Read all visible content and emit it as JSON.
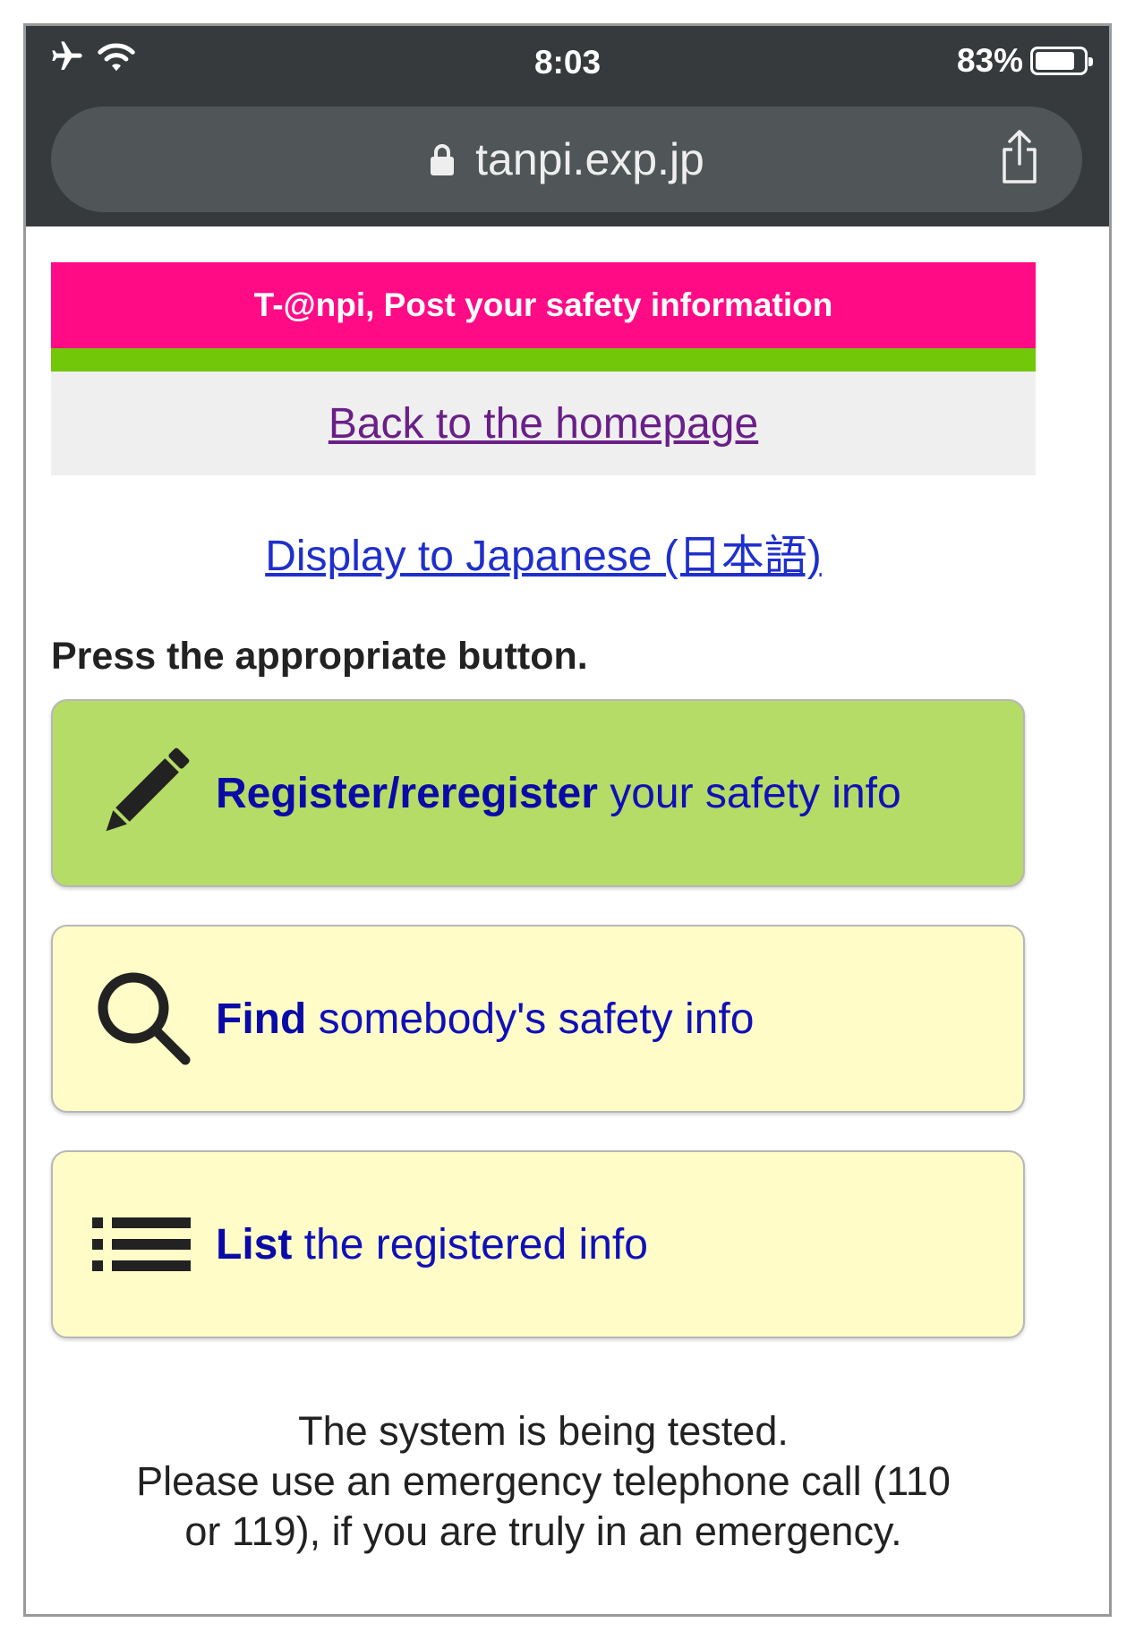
{
  "status_bar": {
    "time": "8:03",
    "battery_percent": "83%",
    "battery_level": 0.83,
    "icons": [
      "airplane-icon",
      "wifi-icon",
      "battery-icon"
    ]
  },
  "browser": {
    "url": "tanpi.exp.jp",
    "icons": [
      "lock-icon",
      "share-icon"
    ]
  },
  "page": {
    "banner_title": "T-@npi, Post your safety information",
    "back_link": "Back to the homepage",
    "language_link": "Display to Japanese (日本語)",
    "instruction": "Press the appropriate button.",
    "buttons": [
      {
        "bold": "Register/reregister",
        "text": " your safety info",
        "icon": "pencil-icon"
      },
      {
        "bold": "Find",
        "text": " somebody's safety info",
        "icon": "search-icon"
      },
      {
        "bold": "List",
        "text": " the registered info",
        "icon": "list-icon"
      }
    ],
    "notice": {
      "line1": "The system is being tested.",
      "line2": "Please use an emergency telephone call (110",
      "line3": "or 119), if you are truly in an emergency."
    }
  },
  "colors": {
    "chrome": "#363a3c",
    "url_bar": "#505557",
    "banner": "#ff0b86",
    "stripe": "#72c708",
    "register_button": "#b5dc66",
    "other_buttons": "#fffcc8",
    "link": "#1f2fcc",
    "visited_link": "#6a1f88"
  }
}
